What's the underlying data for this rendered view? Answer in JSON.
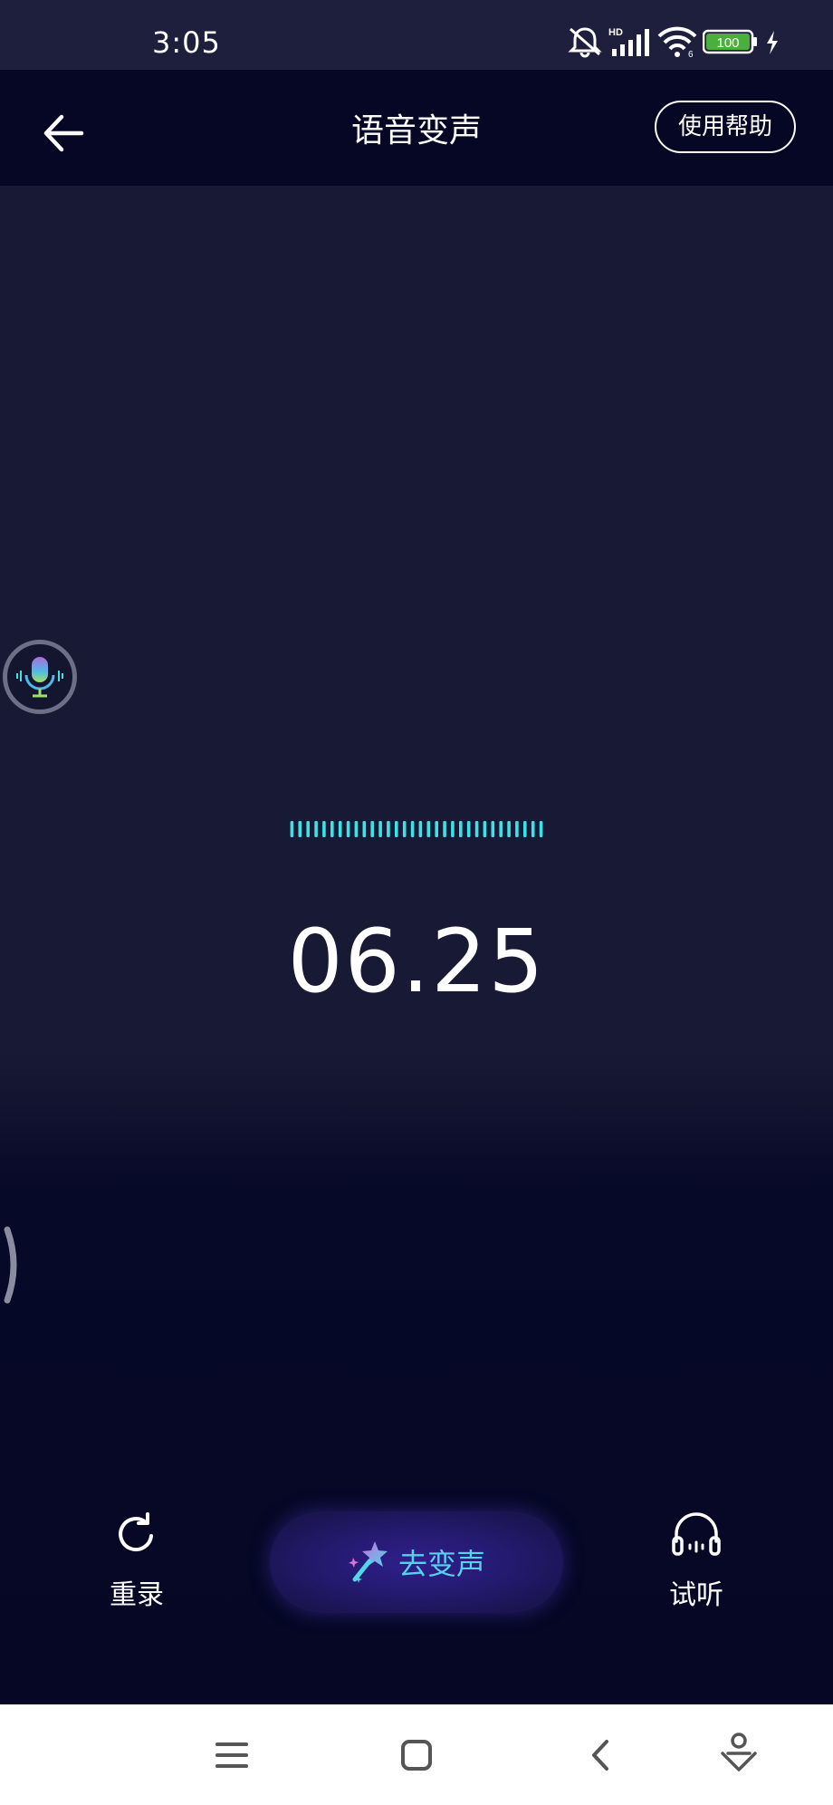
{
  "status_bar": {
    "time": "3:05",
    "battery_level": "100",
    "icons": [
      "mute-icon",
      "hd-signal-icon",
      "wifi-icon",
      "battery-icon",
      "charging-icon"
    ]
  },
  "header": {
    "title": "语音变声",
    "help_label": "使用帮助"
  },
  "recorder": {
    "timer": "06.25"
  },
  "actions": {
    "rerecord_label": "重录",
    "change_voice_label": "去变声",
    "listen_label": "试听"
  },
  "nav_bar": {
    "icons": [
      "menu-icon",
      "home-icon",
      "back-icon",
      "assistant-icon"
    ]
  },
  "colors": {
    "background": "#181a35",
    "header": "#050724",
    "accent_cyan": "#3fe0e6",
    "button_text": "#54d2ec"
  }
}
